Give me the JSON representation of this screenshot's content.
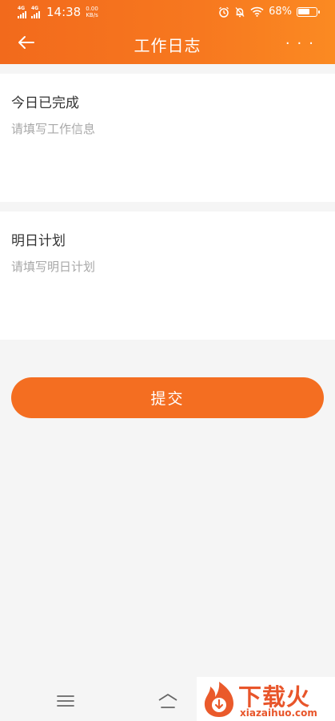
{
  "status_bar": {
    "network_1": "4G",
    "network_2": "4G",
    "time": "14:38",
    "speed_value": "0.00",
    "speed_unit": "KB/s",
    "battery": "68%",
    "battery_level": 0.68
  },
  "header": {
    "title": "工作日志",
    "more": "···"
  },
  "today": {
    "label": "今日已完成",
    "placeholder": "请填写工作信息",
    "value": ""
  },
  "tomorrow": {
    "label": "明日计划",
    "placeholder": "请填写明日计划",
    "value": ""
  },
  "submit_label": "提交",
  "watermark": {
    "title": "下载火",
    "url": "xiazaihuo.com"
  },
  "colors": {
    "accent": "#f46e21",
    "header_start": "#f26a1c",
    "header_end": "#fb8a22",
    "background": "#f5f5f5"
  }
}
